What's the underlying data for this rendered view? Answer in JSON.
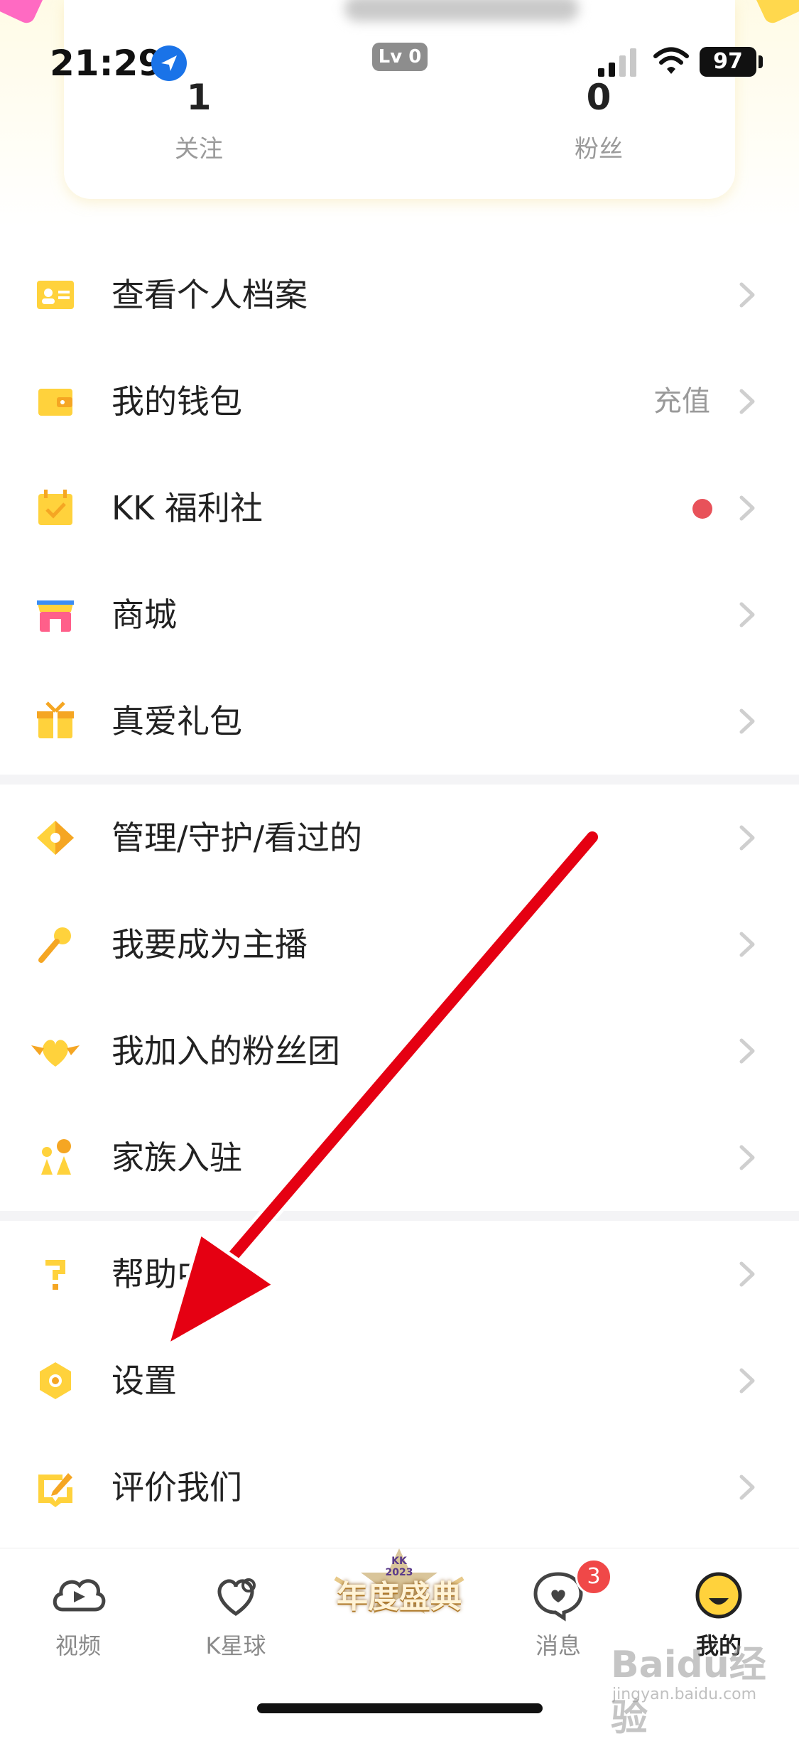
{
  "status_bar": {
    "time": "21:29",
    "battery": "97",
    "level_badge": "Lv 0"
  },
  "profile": {
    "stats": [
      {
        "value": "1",
        "label": "关注"
      },
      {
        "value": "0",
        "label": "粉丝"
      }
    ]
  },
  "menu": {
    "group1": [
      {
        "label": "查看个人档案",
        "icon": "profile-card-icon"
      },
      {
        "label": "我的钱包",
        "icon": "wallet-icon",
        "extra": "充值"
      },
      {
        "label": "KK 福利社",
        "icon": "calendar-check-icon",
        "dot": true
      },
      {
        "label": "商城",
        "icon": "shop-icon"
      },
      {
        "label": "真爱礼包",
        "icon": "gift-icon"
      }
    ],
    "group2": [
      {
        "label": "管理/守护/看过的",
        "icon": "diamond-icon"
      },
      {
        "label": "我要成为主播",
        "icon": "microphone-icon"
      },
      {
        "label": "我加入的粉丝团",
        "icon": "heart-wings-icon"
      },
      {
        "label": "家族入驻",
        "icon": "family-icon"
      }
    ],
    "group3": [
      {
        "label": "帮助中心",
        "icon": "question-icon"
      },
      {
        "label": "设置",
        "icon": "settings-icon"
      },
      {
        "label": "评价我们",
        "icon": "review-icon"
      }
    ]
  },
  "tabbar": {
    "tabs": [
      {
        "label": "视频",
        "icon": "video-cloud-icon"
      },
      {
        "label": "K星球",
        "icon": "heart-planet-icon"
      },
      {
        "label": "",
        "icon": "annual-event-banner-icon",
        "banner_text": "年度盛典",
        "banner_sub": "KK 2023"
      },
      {
        "label": "消息",
        "icon": "message-heart-icon",
        "badge": "3"
      },
      {
        "label": "我的",
        "icon": "smiley-face-icon"
      }
    ]
  },
  "watermark": {
    "text": "Baidu经验",
    "sub": "jingyan.baidu.com"
  },
  "colors": {
    "accent_yellow": "#ffd23c",
    "icon_orange": "#f5a623",
    "red_dot": "#e8525a",
    "arrow": "#e50012"
  }
}
